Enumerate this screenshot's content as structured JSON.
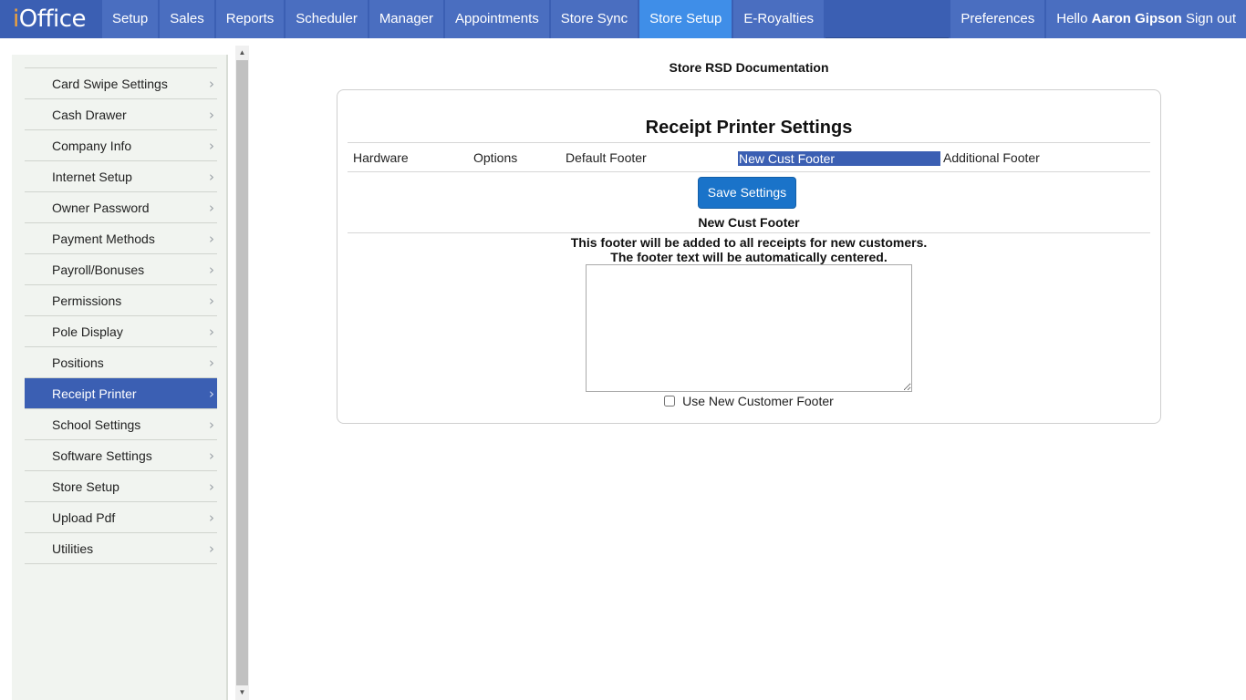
{
  "app": {
    "logo_i": "i",
    "logo_rest": "Office"
  },
  "nav": {
    "tabs": [
      {
        "label": "Setup"
      },
      {
        "label": "Sales"
      },
      {
        "label": "Reports"
      },
      {
        "label": "Scheduler"
      },
      {
        "label": "Manager"
      },
      {
        "label": "Appointments"
      },
      {
        "label": "Store Sync"
      },
      {
        "label": "Store Setup"
      },
      {
        "label": "E-Royalties"
      }
    ],
    "active_tab": "Store Setup",
    "preferences_label": "Preferences",
    "greeting": "Hello",
    "user_name": "Aaron Gipson",
    "signout_label": "Sign out"
  },
  "sidebar": {
    "items": [
      {
        "label": "Card Swipe Settings"
      },
      {
        "label": "Cash Drawer"
      },
      {
        "label": "Company Info"
      },
      {
        "label": "Internet Setup"
      },
      {
        "label": "Owner Password"
      },
      {
        "label": "Payment Methods"
      },
      {
        "label": "Payroll/Bonuses"
      },
      {
        "label": "Permissions"
      },
      {
        "label": "Pole Display"
      },
      {
        "label": "Positions"
      },
      {
        "label": "Receipt Printer"
      },
      {
        "label": "School Settings"
      },
      {
        "label": "Software Settings"
      },
      {
        "label": "Store Setup"
      },
      {
        "label": "Upload Pdf"
      },
      {
        "label": "Utilities"
      }
    ],
    "active_item": "Receipt Printer"
  },
  "main": {
    "doc_title": "Store RSD Documentation",
    "panel_title": "Receipt Printer Settings",
    "tabs": [
      {
        "label": "Hardware"
      },
      {
        "label": "Options"
      },
      {
        "label": "Default Footer"
      },
      {
        "label": "New Cust Footer"
      },
      {
        "label": "Additional Footer"
      }
    ],
    "selected_tab": "New Cust Footer",
    "save_label": "Save Settings",
    "section_title": "New Cust Footer",
    "desc_line1": "This footer will be added to all receipts for new customers.",
    "desc_line2": "The footer text will be automatically centered.",
    "footer_value": "",
    "checkbox_label": "Use New Customer Footer",
    "checkbox_checked": false
  },
  "colors": {
    "nav_bg": "#3b5fb3",
    "nav_tab_bg": "#4a6ec0",
    "nav_active": "#3f8ee8",
    "sidebar_active": "#3b5fb3",
    "button": "#1a73c9"
  }
}
